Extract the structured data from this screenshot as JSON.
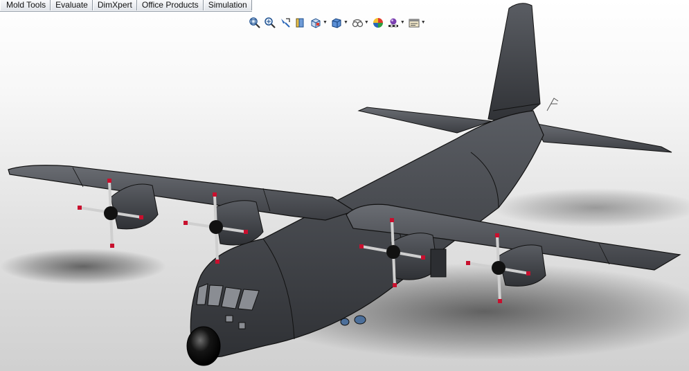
{
  "tabs": [
    {
      "label": "Mold Tools"
    },
    {
      "label": "Evaluate"
    },
    {
      "label": "DimXpert"
    },
    {
      "label": "Office Products"
    },
    {
      "label": "Simulation"
    }
  ],
  "view_toolbar": [
    {
      "icon": "zoom-to-fit-icon"
    },
    {
      "icon": "zoom-to-area-icon"
    },
    {
      "icon": "previous-view-icon"
    },
    {
      "icon": "section-view-icon"
    },
    {
      "icon": "view-orientation-icon",
      "dropdown": true
    },
    {
      "icon": "display-style-icon",
      "dropdown": true
    },
    {
      "icon": "hide-show-items-icon",
      "dropdown": true
    },
    {
      "icon": "edit-appearance-icon"
    },
    {
      "icon": "apply-scene-icon",
      "dropdown": true
    },
    {
      "icon": "view-settings-icon",
      "dropdown": true
    }
  ],
  "colors": {
    "model_body": "#474a4f",
    "model_edge": "#111111",
    "propeller_tip": "#c8102e",
    "background_top": "#ffffff",
    "background_bottom": "#d0d0d0"
  }
}
